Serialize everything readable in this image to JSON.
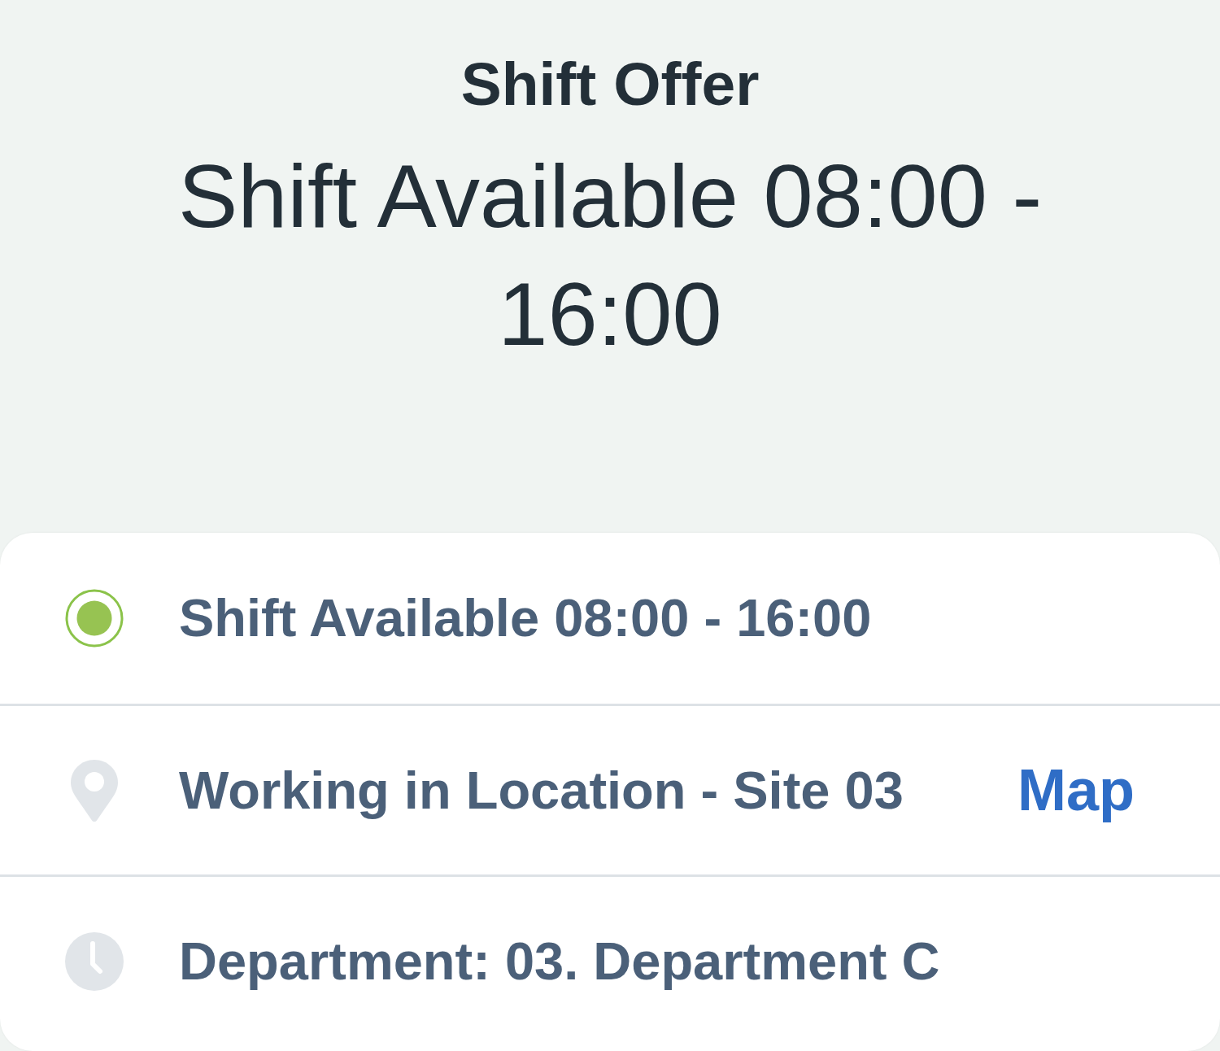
{
  "header": {
    "title": "Shift Offer",
    "subtitle": "Shift Available 08:00 - 16:00"
  },
  "details": [
    {
      "kind": "status",
      "text": "Shift Available 08:00 - 16:00"
    },
    {
      "kind": "location",
      "text": "Working in Location - Site 03",
      "action": "Map"
    },
    {
      "kind": "department",
      "text": "Department: 03. Department C"
    }
  ]
}
